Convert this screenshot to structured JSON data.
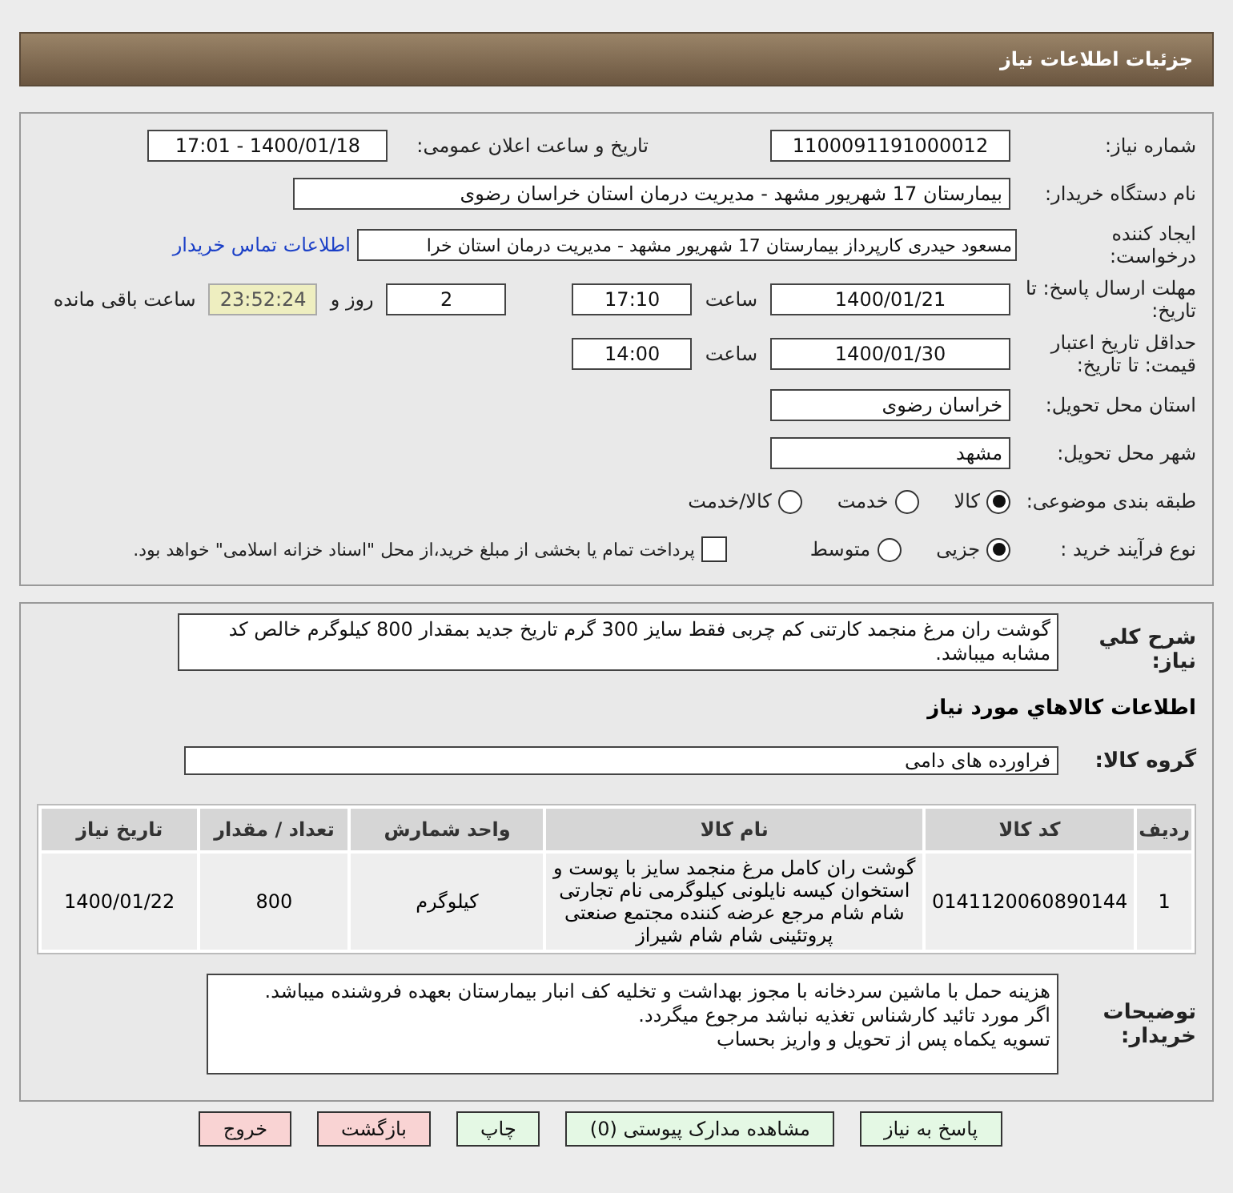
{
  "header": {
    "title": "جزئیات اطلاعات نیاز"
  },
  "details": {
    "need_number": {
      "label": "شماره نیاز:",
      "value": "1100091191000012"
    },
    "announce": {
      "label": "تاریخ و ساعت اعلان عمومی:",
      "value": "1400/01/18 - 17:01"
    },
    "buyer": {
      "label": "نام دستگاه خریدار:",
      "value": "بیمارستان 17 شهریور مشهد - مدیریت درمان استان خراسان رضوی"
    },
    "creator": {
      "label": "ایجاد کننده درخواست:",
      "value": "مسعود حیدری کارپرداز بیمارستان 17 شهریور مشهد - مدیریت درمان استان خرا",
      "link": "اطلاعات تماس خریدار"
    },
    "deadline": {
      "label": "مهلت ارسال پاسخ: تا تاریخ:",
      "date": "1400/01/21",
      "time_label": "ساعت",
      "time": "17:10",
      "days": "2",
      "days_label": "روز و",
      "remaining": "23:52:24",
      "remaining_label": "ساعت باقی مانده"
    },
    "validity": {
      "label": "حداقل تاریخ اعتبار قیمت: تا تاریخ:",
      "date": "1400/01/30",
      "time_label": "ساعت",
      "time": "14:00"
    },
    "province": {
      "label": "استان محل تحویل:",
      "value": "خراسان رضوی"
    },
    "city": {
      "label": "شهر محل تحویل:",
      "value": "مشهد"
    },
    "category": {
      "label": "طبقه بندی موضوعی:",
      "options": [
        {
          "label": "کالا",
          "selected": true
        },
        {
          "label": "خدمت",
          "selected": false
        },
        {
          "label": "کالا/خدمت",
          "selected": false
        }
      ]
    },
    "process": {
      "label": "نوع فرآیند خرید :",
      "options": [
        {
          "label": "جزیی",
          "selected": true
        },
        {
          "label": "متوسط",
          "selected": false
        }
      ],
      "treasury": {
        "label": "پرداخت تمام یا بخشی از مبلغ خرید،از محل \"اسناد خزانه اسلامی\" خواهد بود.",
        "checked": false
      }
    }
  },
  "summary": {
    "label": "شرح کلي نیاز:",
    "value": "گوشت ران مرغ منجمد  کارتنی کم چربی فقط سایز 300 گرم  تاریخ جدید بمقدار 800 کیلوگرم خالص کد مشابه میباشد."
  },
  "goods": {
    "heading": "اطلاعات کالاهاي مورد نیاز",
    "group": {
      "label": "گروه کالا:",
      "value": "فراورده های دامی"
    },
    "table": {
      "columns": [
        "ردیف",
        "کد کالا",
        "نام کالا",
        "واحد شمارش",
        "تعداد / مقدار",
        "تاریخ نیاز"
      ],
      "rows": [
        [
          "1",
          "0141120060890144",
          "گوشت ران کامل مرغ منجمد سایز با پوست و استخوان کیسه نایلونی کیلوگرمی نام تجارتی شام شام مرجع عرضه کننده مجتمع صنعتی پروتئینی شام شام شیراز",
          "کیلوگرم",
          "800",
          "1400/01/22"
        ]
      ]
    }
  },
  "notes": {
    "label": "توضیحات خریدار:",
    "lines": [
      "هزینه حمل با ماشین سردخانه با مجوز بهداشت و تخلیه کف انبار بیمارستان بعهده فروشنده میباشد.",
      "اگر مورد تائید کارشناس تغذیه نباشد مرجوع میگردد.",
      "تسویه یکماه پس از تحویل و واریز بحساب"
    ]
  },
  "buttons": [
    {
      "label": "پاسخ به نیاز",
      "kind": "go"
    },
    {
      "label": "مشاهده مدارک پیوستی (0)",
      "kind": "go"
    },
    {
      "label": "چاپ",
      "kind": "go"
    },
    {
      "label": "بازگشت",
      "kind": "back"
    },
    {
      "label": "خروج",
      "kind": "back"
    }
  ]
}
